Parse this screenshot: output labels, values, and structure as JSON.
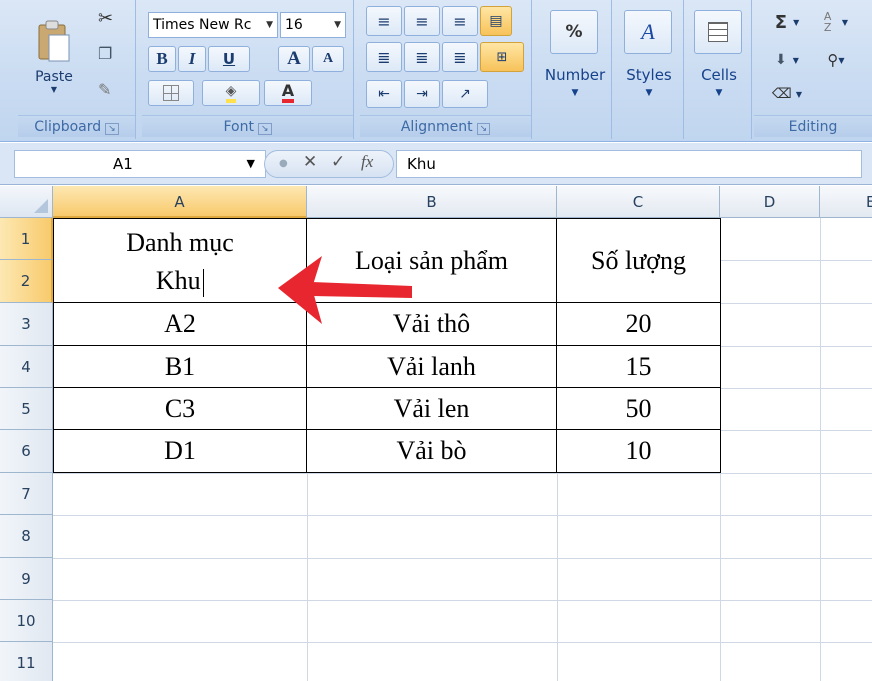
{
  "ribbon": {
    "clipboard": {
      "label": "Clipboard",
      "paste": "Paste"
    },
    "font": {
      "label": "Font",
      "name": "Times New Rc",
      "size": "16",
      "bold": "B",
      "italic": "I",
      "underline": "U",
      "grow": "A",
      "shrink": "A",
      "fontcolor": "A"
    },
    "alignment": {
      "label": "Alignment"
    },
    "number": {
      "label": "Number",
      "symbol": "%"
    },
    "styles": {
      "label": "Styles",
      "symbol": "A"
    },
    "cells": {
      "label": "Cells"
    },
    "editing": {
      "label": "Editing",
      "sum": "Σ",
      "sort": "A Z"
    }
  },
  "formula_bar": {
    "name_box": "A1",
    "value": "Khu",
    "cancel": "✕",
    "enter": "✓",
    "fx": "fx"
  },
  "columns": [
    "A",
    "B",
    "C",
    "D",
    "E"
  ],
  "rows": [
    "1",
    "2",
    "3",
    "4",
    "5",
    "6",
    "7",
    "8",
    "9",
    "10",
    "11"
  ],
  "table": {
    "a1_line1": "Danh mục",
    "a1_line2": "Khu",
    "b_header": "Loại sản phẩm",
    "c_header": "Số lượng",
    "body": [
      {
        "a": "A2",
        "b": "Vải thô",
        "c": "20"
      },
      {
        "a": "B1",
        "b": "Vải lanh",
        "c": "15"
      },
      {
        "a": "C3",
        "b": "Vải len",
        "c": "50"
      },
      {
        "a": "D1",
        "b": "Vải bò",
        "c": "10"
      }
    ]
  },
  "colors": {
    "arrow": "#e8262f",
    "ribbon": "#cadcf2",
    "selection": "#f8ca6d"
  }
}
